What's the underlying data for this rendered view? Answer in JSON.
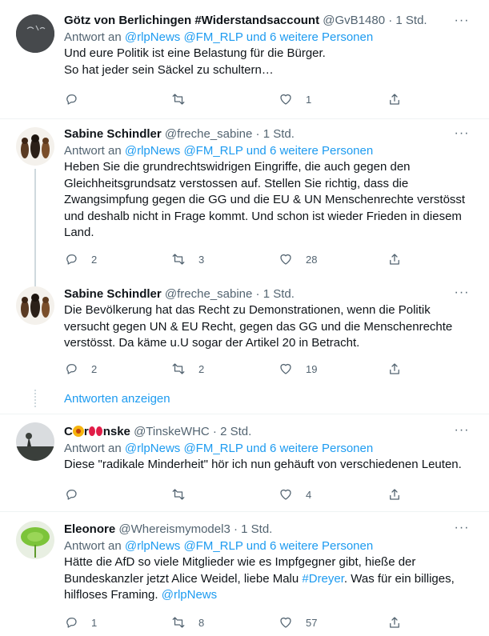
{
  "tweets": [
    {
      "name": "Götz von Berlichingen #Widerstandsaccount",
      "handle": "@GvB1480",
      "time": "1 Std.",
      "reply_prefix": "Antwort an ",
      "reply_links": "@rlpNews @FM_RLP und 6 weitere Personen",
      "lines": [
        "Und eure Politik ist eine Belastung für die Bürger.",
        "So hat jeder sein Säckel zu schultern…"
      ],
      "replies": "",
      "retweets": "",
      "likes": "1"
    },
    {
      "name": "Sabine Schindler",
      "handle": "@freche_sabine",
      "time": "1 Std.",
      "reply_prefix": "Antwort an ",
      "reply_links": "@rlpNews @FM_RLP und 6 weitere Personen",
      "lines": [
        "Heben Sie die grundrechtswidrigen Eingriffe, die auch gegen den",
        "Gleichheitsgrundsatz verstossen auf. Stellen Sie richtig, dass die",
        "Zwangsimpfung gegen die GG und die EU & UN Menschenrechte verstösst",
        "und deshalb nicht in Frage kommt. Und schon ist wieder Frieden in diesem",
        "Land."
      ],
      "replies": "2",
      "retweets": "3",
      "likes": "28"
    },
    {
      "name": "Sabine Schindler",
      "handle": "@freche_sabine",
      "time": "1 Std.",
      "lines": [
        "Die Bevölkerung hat das Recht zu Demonstrationen, wenn die Politik",
        "versucht gegen UN & EU Recht, gegen das GG und die Menschenrechte",
        "verstösst. Da käme u.U sogar der Artikel 20 in Betracht."
      ],
      "replies": "2",
      "retweets": "2",
      "likes": "19"
    },
    {
      "name_c": "C",
      "name_r": "r",
      "name_rest": "nske",
      "handle": "@TinskeWHC",
      "time": "2 Std.",
      "reply_prefix": "Antwort an ",
      "reply_links": "@rlpNews @FM_RLP und 6 weitere Personen",
      "lines": [
        "Diese \"radikale Minderheit\" hör ich nun gehäuft von verschiedenen Leuten."
      ],
      "replies": "",
      "retweets": "",
      "likes": "4"
    },
    {
      "name": "Eleonore",
      "handle": "@Whereismymodel3",
      "time": "1 Std.",
      "reply_prefix": "Antwort an ",
      "reply_links": "@rlpNews @FM_RLP und 6 weitere Personen",
      "line1": "Hätte die AfD so viele Mitglieder wie es Impfgegner gibt, hieße der",
      "line2_a": "Bundeskanzler jetzt Alice Weidel, liebe Malu ",
      "line2_link": "#Dreyer",
      "line2_b": ". Was für ein billiges,",
      "line3_a": "hilfloses Framing. ",
      "line3_link": "@rlpNews",
      "replies": "1",
      "retweets": "8",
      "likes": "57"
    }
  ],
  "show_replies": "Antworten anzeigen",
  "dot": "·",
  "more": "···"
}
